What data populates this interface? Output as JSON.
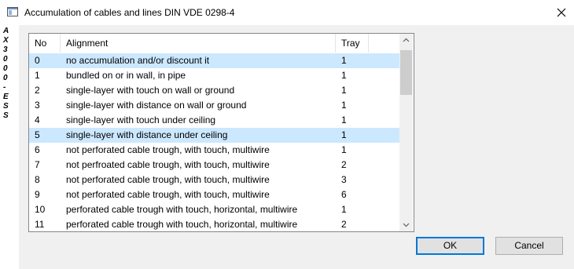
{
  "window": {
    "title": "Accumulation of cables and lines DIN VDE 0298-4",
    "icon": "window-icon",
    "close_icon": "close-icon"
  },
  "sidebar": {
    "vertical_text": "AX3000 - ESS"
  },
  "table": {
    "columns": [
      "No",
      "Alignment",
      "Tray"
    ],
    "rows": [
      {
        "no": "0",
        "alignment": "no accumulation and/or discount it",
        "tray": "1",
        "selected": true
      },
      {
        "no": "1",
        "alignment": "bundled on or in wall, in pipe",
        "tray": "1",
        "selected": false
      },
      {
        "no": "2",
        "alignment": "single-layer with touch on wall or ground",
        "tray": "1",
        "selected": false
      },
      {
        "no": "3",
        "alignment": "single-layer with distance on wall or ground",
        "tray": "1",
        "selected": false
      },
      {
        "no": "4",
        "alignment": "single-layer with touch under ceiling",
        "tray": "1",
        "selected": false
      },
      {
        "no": "5",
        "alignment": "single-layer with distance under ceiling",
        "tray": "1",
        "selected": true
      },
      {
        "no": "6",
        "alignment": "not perforated cable trough, with touch, multiwire",
        "tray": "1",
        "selected": false
      },
      {
        "no": "7",
        "alignment": "not perfroated cable trough, with touch, multiwire",
        "tray": "2",
        "selected": false
      },
      {
        "no": "8",
        "alignment": "not perforated cable trough, with touch, multiwire",
        "tray": "3",
        "selected": false
      },
      {
        "no": "9",
        "alignment": "not perforated cable trough, with touch, multiwire",
        "tray": "6",
        "selected": false
      },
      {
        "no": "10",
        "alignment": "perforated cable trough with touch, horizontal, multiwire",
        "tray": "1",
        "selected": false
      },
      {
        "no": "11",
        "alignment": "perforated cable trough with touch, horizontal, multiwire",
        "tray": "2",
        "selected": false
      }
    ],
    "scrollbar": {
      "up_icon": "chevron-up-icon",
      "down_icon": "chevron-down-icon"
    }
  },
  "buttons": {
    "ok": "OK",
    "cancel": "Cancel"
  },
  "colors": {
    "selection": "#cce8ff",
    "dialog_bg": "#f0f0f0",
    "default_button_border": "#0078d7"
  }
}
